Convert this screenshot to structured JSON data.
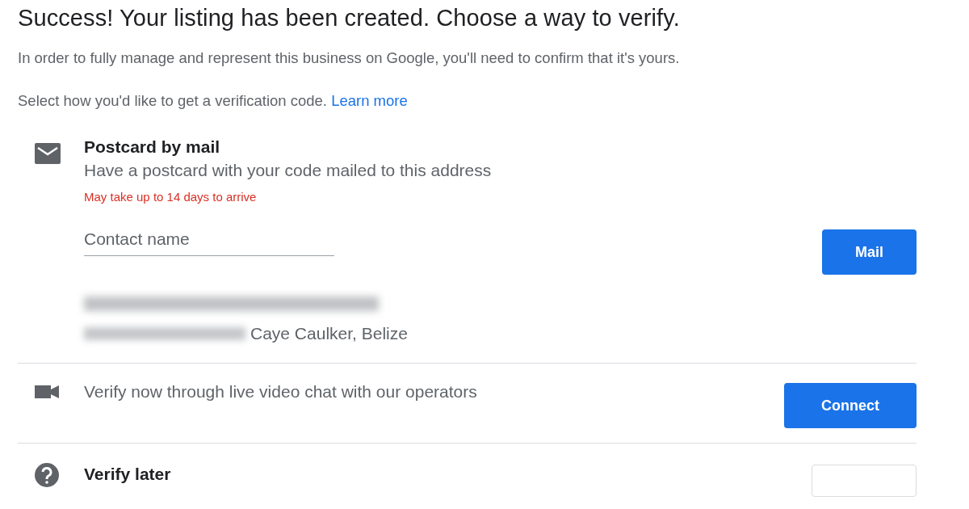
{
  "heading": "Success! Your listing has been created. Choose a way to verify.",
  "intro": "In order to fully manage and represent this business on Google, you'll need to confirm that it's yours.",
  "prompt": {
    "text": "Select how you'd like to get a verification code.",
    "link": "Learn more"
  },
  "options": [
    {
      "kind": "postcard",
      "title": "Postcard by mail",
      "description": "Have a postcard with your code mailed to this address",
      "note": "May take up to 14 days to arrive",
      "field": {
        "placeholder": "Contact name"
      },
      "address_city": "Caye Caulker, Belize",
      "button": "Mail"
    },
    {
      "kind": "video",
      "description": "Verify now through live video chat with our operators",
      "button": "Connect"
    },
    {
      "kind": "later",
      "title": "Verify later"
    }
  ]
}
